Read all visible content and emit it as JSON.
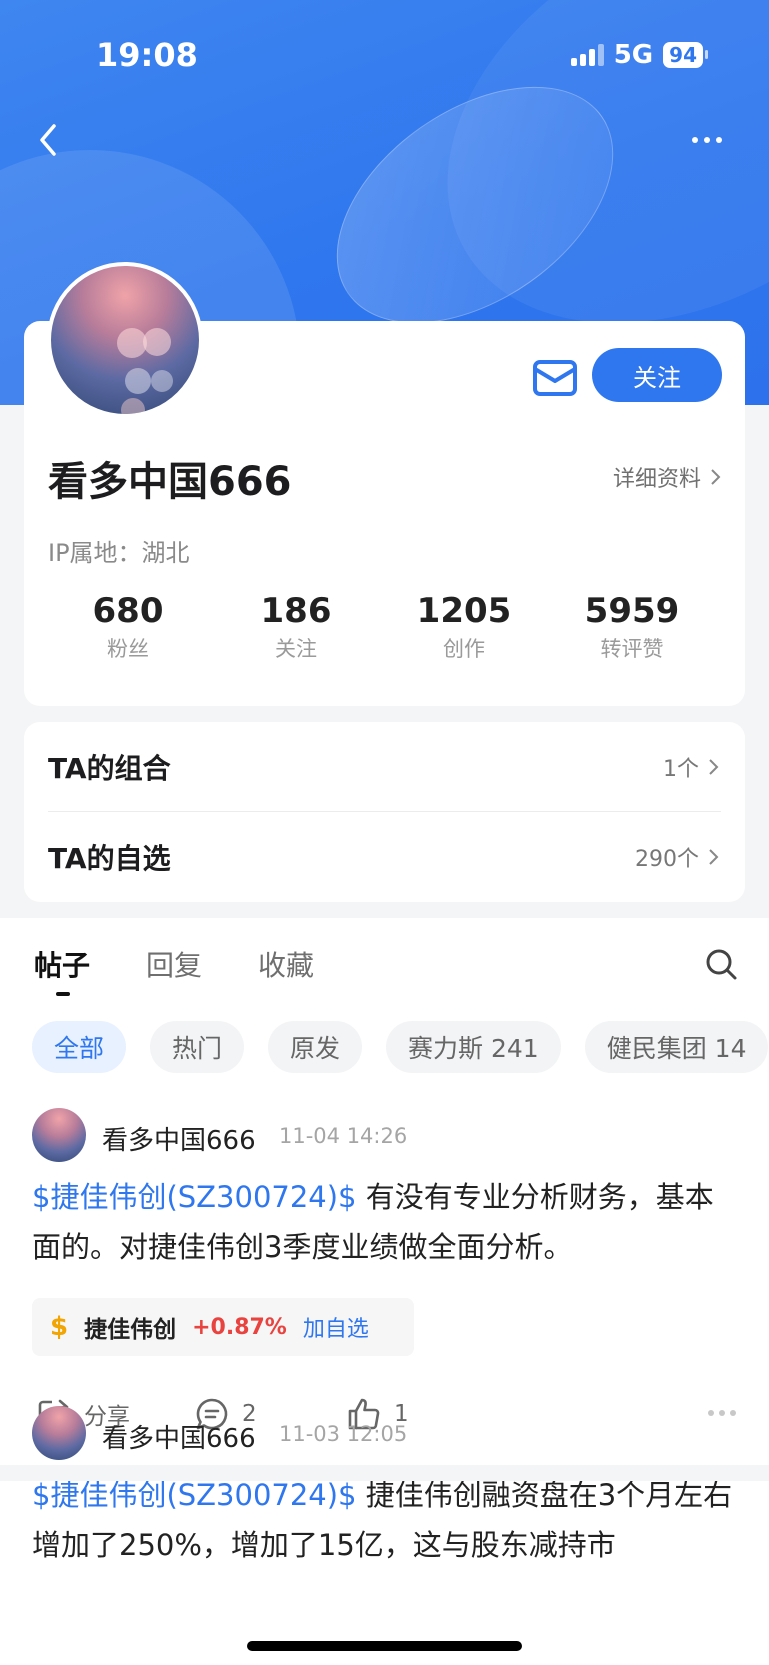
{
  "status_bar": {
    "time": "19:08",
    "network": "5G",
    "battery": "94"
  },
  "nav": {
    "back_icon": "chevron-left-icon",
    "more_icon": "more-dots-icon"
  },
  "profile": {
    "name": "看多中国666",
    "follow_label": "关注",
    "detail_label": "详细资料",
    "ip_label": "IP属地：湖北",
    "stats": [
      {
        "value": "680",
        "label": "粉丝"
      },
      {
        "value": "186",
        "label": "关注"
      },
      {
        "value": "1205",
        "label": "创作"
      },
      {
        "value": "5959",
        "label": "转评赞"
      }
    ]
  },
  "lists": [
    {
      "title": "TA的组合",
      "value": "1个"
    },
    {
      "title": "TA的自选",
      "value": "290个"
    }
  ],
  "tabs": [
    "帖子",
    "回复",
    "收藏"
  ],
  "chips": [
    "全部",
    "热门",
    "原发",
    "赛力斯 241",
    "健民集团 14"
  ],
  "posts": [
    {
      "user": "看多中国666",
      "time": "11-04 14:26",
      "stock_tag": "$捷佳伟创(SZ300724)$",
      "text": " 有没有专业分析财务，基本面的。对捷佳伟创3季度业绩做全面分析。",
      "stock_card": {
        "symbol": "$",
        "name": "捷佳伟创",
        "change": "+0.87%",
        "add_label": "加自选"
      },
      "share_label": "分享",
      "comments": "2",
      "likes": "1"
    },
    {
      "user": "看多中国666",
      "time": "11-03 12:05",
      "stock_tag": "$捷佳伟创(SZ300724)$",
      "text": " 捷佳伟创融资盘在3个月左右增加了250%，增加了15亿，这与股东减持市"
    }
  ],
  "colors": {
    "accent": "#2f77ee",
    "up": "#e8433f",
    "dollar": "#f2a400"
  }
}
